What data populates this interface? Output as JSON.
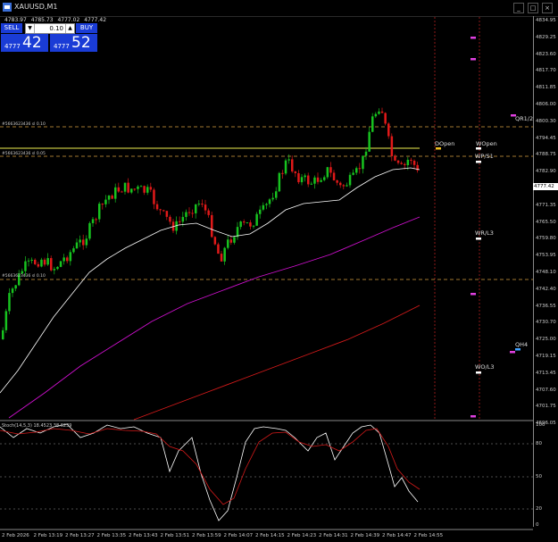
{
  "window": {
    "title": "XAUUSD,M1"
  },
  "ohlc": {
    "open": "4783.97",
    "high": "4785.73",
    "low": "4777.02",
    "close": "4777.42"
  },
  "trade_panel": {
    "sell_label": "SELL",
    "buy_label": "BUY",
    "lot": "0.10",
    "bid_small": "4777",
    "bid_big": "42",
    "ask_small": "4777",
    "ask_big": "52"
  },
  "price_axis": [
    "4834.95",
    "4829.25",
    "4823.60",
    "4817.70",
    "4811.85",
    "4806.00",
    "4800.30",
    "4794.45",
    "4788.75",
    "4782.90",
    "4777.00",
    "4771.35",
    "4765.50",
    "4759.80",
    "4753.95",
    "4748.10",
    "4742.40",
    "4736.55",
    "4730.70",
    "4725.00",
    "4719.15",
    "4713.45",
    "4707.60",
    "4701.75",
    "4696.05"
  ],
  "current_price": "4777.42",
  "time_axis": [
    "2 Feb 2026",
    "2 Feb 13:19",
    "2 Feb 13:27",
    "2 Feb 13:35",
    "2 Feb 13:43",
    "2 Feb 13:51",
    "2 Feb 13:59",
    "2 Feb 14:07",
    "2 Feb 14:15",
    "2 Feb 14:23",
    "2 Feb 14:31",
    "2 Feb 14:39",
    "2 Feb 14:47",
    "2 Feb 14:55"
  ],
  "order_lines": {
    "tp_label": "#5663623436 sl 0.10",
    "entry_label": "#5663623436 sl 0.05",
    "sl_label": "#5663623436 sl 0.10"
  },
  "levels": {
    "dopen": "DOpen",
    "wopen": "WOpen",
    "wp_s1": "WP/S1",
    "qr1_2": "QR1/2",
    "wr_l3": "WR/L3",
    "qh4": "QH4",
    "wo_l3": "WO/L3"
  },
  "oscillator": {
    "header": "Stoch(14,5,3) 18.4523 38.6239",
    "levels": [
      "100",
      "80",
      "50",
      "20",
      "0"
    ]
  },
  "colors": {
    "bull": "#17c21f",
    "bear": "#e01919",
    "ma_fast": "#ffffff",
    "ma_mid": "#d010d0",
    "ma_slow": "#d41a1a",
    "order_line": "#d8a040",
    "yellow": "#f0f050"
  }
}
